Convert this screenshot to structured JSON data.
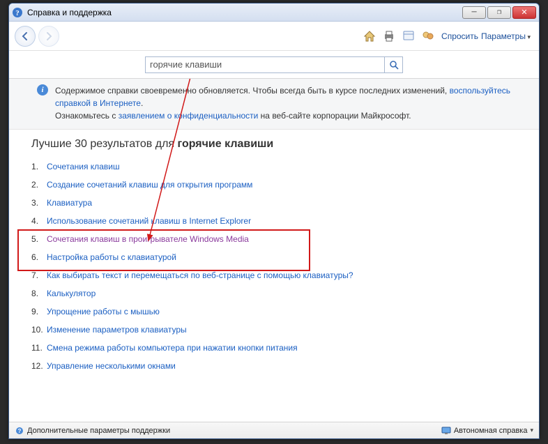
{
  "window": {
    "title": "Справка и поддержка"
  },
  "toolbar": {
    "ask": "Спросить",
    "settings": "Параметры"
  },
  "search": {
    "value": "горячие клавиши"
  },
  "info": {
    "text1": "Содержимое справки своевременно обновляется. Чтобы всегда быть в курсе последних изменений, ",
    "link1": "воспользуйтесь справкой в Интернете",
    "period1": ".",
    "text2": "Ознакомьтесь с ",
    "link2": "заявлением о конфиденциальности",
    "text3": " на веб-сайте корпорации Майкрософт."
  },
  "results": {
    "header_prefix": "Лучшие 30 результатов для ",
    "query": "горячие клавиши",
    "items": [
      {
        "label": "Сочетания клавиш"
      },
      {
        "label": "Создание сочетаний клавиш для открытия программ"
      },
      {
        "label": "Клавиатура"
      },
      {
        "label": "Использование сочетаний клавиш в Internet Explorer"
      },
      {
        "label": "Сочетания клавиш в проигрывателе Windows Media",
        "visited": true
      },
      {
        "label": "Настройка работы с клавиатурой"
      },
      {
        "label": "Как выбирать текст и перемещаться по веб-странице с помощью клавиатуры?"
      },
      {
        "label": "Калькулятор"
      },
      {
        "label": "Упрощение работы с мышью"
      },
      {
        "label": "Изменение параметров клавиатуры"
      },
      {
        "label": "Смена режима работы компьютера при нажатии кнопки питания"
      },
      {
        "label": "Управление несколькими окнами"
      }
    ]
  },
  "status": {
    "left": "Дополнительные параметры поддержки",
    "right": "Автономная справка"
  }
}
